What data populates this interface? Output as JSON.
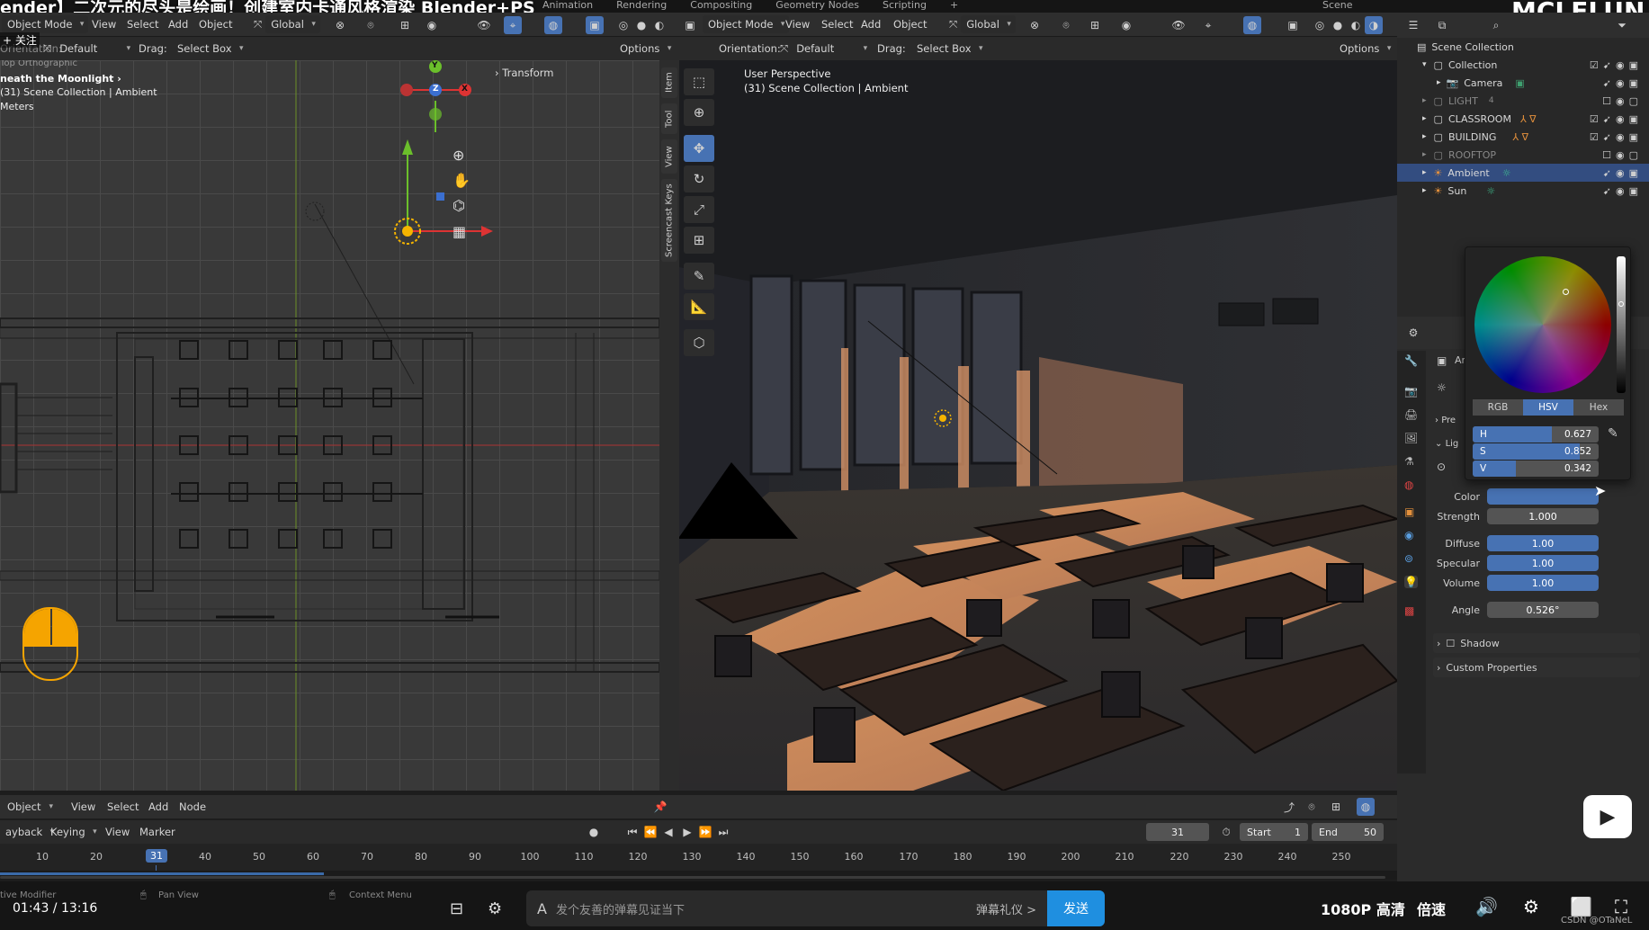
{
  "video_overlay": {
    "title": "ender】二次元的尽头是绘画！创建室内卡通风格渲染 Blender+PS",
    "watermark": "MCLELUN",
    "follow_label": "+ 关注"
  },
  "top_menu": {
    "workspaces": [
      "Animation",
      "Rendering",
      "Compositing",
      "Geometry Nodes",
      "Scripting",
      "+"
    ],
    "scene_label": "Scene"
  },
  "left_viewport": {
    "mode": "Object Mode",
    "menus": [
      "View",
      "Select",
      "Add",
      "Object"
    ],
    "transform_orientation": "Global",
    "orientation_label": "Orientation:",
    "orientation_value": "Default",
    "drag_label": "Drag:",
    "drag_value": "Select Box",
    "options_label": "Options",
    "overlay_title": "Top Orthographic",
    "overlay_breadcrumb": "neath the Moonlight",
    "overlay_collection": "(31) Scene Collection | Ambient",
    "overlay_units": "Meters",
    "transform_panel_label": "Transform",
    "side_tabs": [
      "Item",
      "Tool",
      "View",
      "Screencast Keys"
    ],
    "gizmo_axes": {
      "x": "X",
      "y": "Y",
      "z": "Z"
    }
  },
  "right_viewport": {
    "mode": "Object Mode",
    "menus": [
      "View",
      "Select",
      "Add",
      "Object"
    ],
    "transform_orientation": "Global",
    "orientation_label": "Orientation:",
    "orientation_value": "Default",
    "drag_label": "Drag:",
    "drag_value": "Select Box",
    "options_label": "Options",
    "overlay_title": "User Perspective",
    "overlay_collection": "(31) Scene Collection | Ambient"
  },
  "outliner": {
    "root": "Scene Collection",
    "items": [
      {
        "name": "Collection",
        "level": 1
      },
      {
        "name": "Camera",
        "level": 2
      },
      {
        "name": "LIGHT",
        "level": 1,
        "count": "4"
      },
      {
        "name": "CLASSROOM",
        "level": 1
      },
      {
        "name": "BUILDING",
        "level": 1
      },
      {
        "name": "ROOFTOP",
        "level": 1
      },
      {
        "name": "Ambient",
        "level": 1,
        "selected": true
      },
      {
        "name": "Sun",
        "level": 1
      }
    ]
  },
  "color_picker": {
    "modes": [
      "RGB",
      "HSV",
      "Hex"
    ],
    "active_mode": "HSV",
    "h_label": "H",
    "h_value": "0.627",
    "h_fraction": 0.627,
    "s_label": "S",
    "s_value": "0.852",
    "s_fraction": 0.852,
    "v_label": "V",
    "v_value": "0.342",
    "v_fraction": 0.342
  },
  "properties": {
    "object_name_partial": "Ar",
    "section_preview_partial": "Pre",
    "section_light_partial": "Lig",
    "color_label": "Color",
    "strength_label": "Strength",
    "strength_value": "1.000",
    "diffuse_label": "Diffuse",
    "diffuse_value": "1.00",
    "specular_label": "Specular",
    "specular_value": "1.00",
    "volume_label": "Volume",
    "volume_value": "1.00",
    "angle_label": "Angle",
    "angle_value": "0.526°",
    "shadow_label": "Shadow",
    "custom_props_label": "Custom Properties",
    "color_swatch": "#4772b3"
  },
  "timeline": {
    "node_menu": {
      "mode": "Object",
      "menus": [
        "View",
        "Select",
        "Add",
        "Node"
      ]
    },
    "playback_label": "ayback",
    "keying_label": "Keying",
    "view_label": "View",
    "marker_label": "Marker",
    "current_frame": "31",
    "start_label": "Start",
    "start_value": "1",
    "end_label": "End",
    "end_value": "50",
    "ticks": [
      "10",
      "20",
      "40",
      "50",
      "60",
      "70",
      "80",
      "90",
      "100",
      "110",
      "120",
      "130",
      "140",
      "150",
      "160",
      "170",
      "180",
      "190",
      "200",
      "210",
      "220",
      "230",
      "240",
      "250"
    ],
    "badge": "31"
  },
  "player": {
    "status_left": "tive Modifier",
    "status_pan": "Pan View",
    "status_context": "Context Menu",
    "time_current": "01:43",
    "time_total": "13:16",
    "danmaku_placeholder": "发个友善的弹幕见证当下",
    "danmaku_etiquette": "弹幕礼仪 >",
    "send_label": "发送",
    "quality": "1080P 高清",
    "speed": "倍速",
    "credit": "CSDN @OTaNeL"
  }
}
